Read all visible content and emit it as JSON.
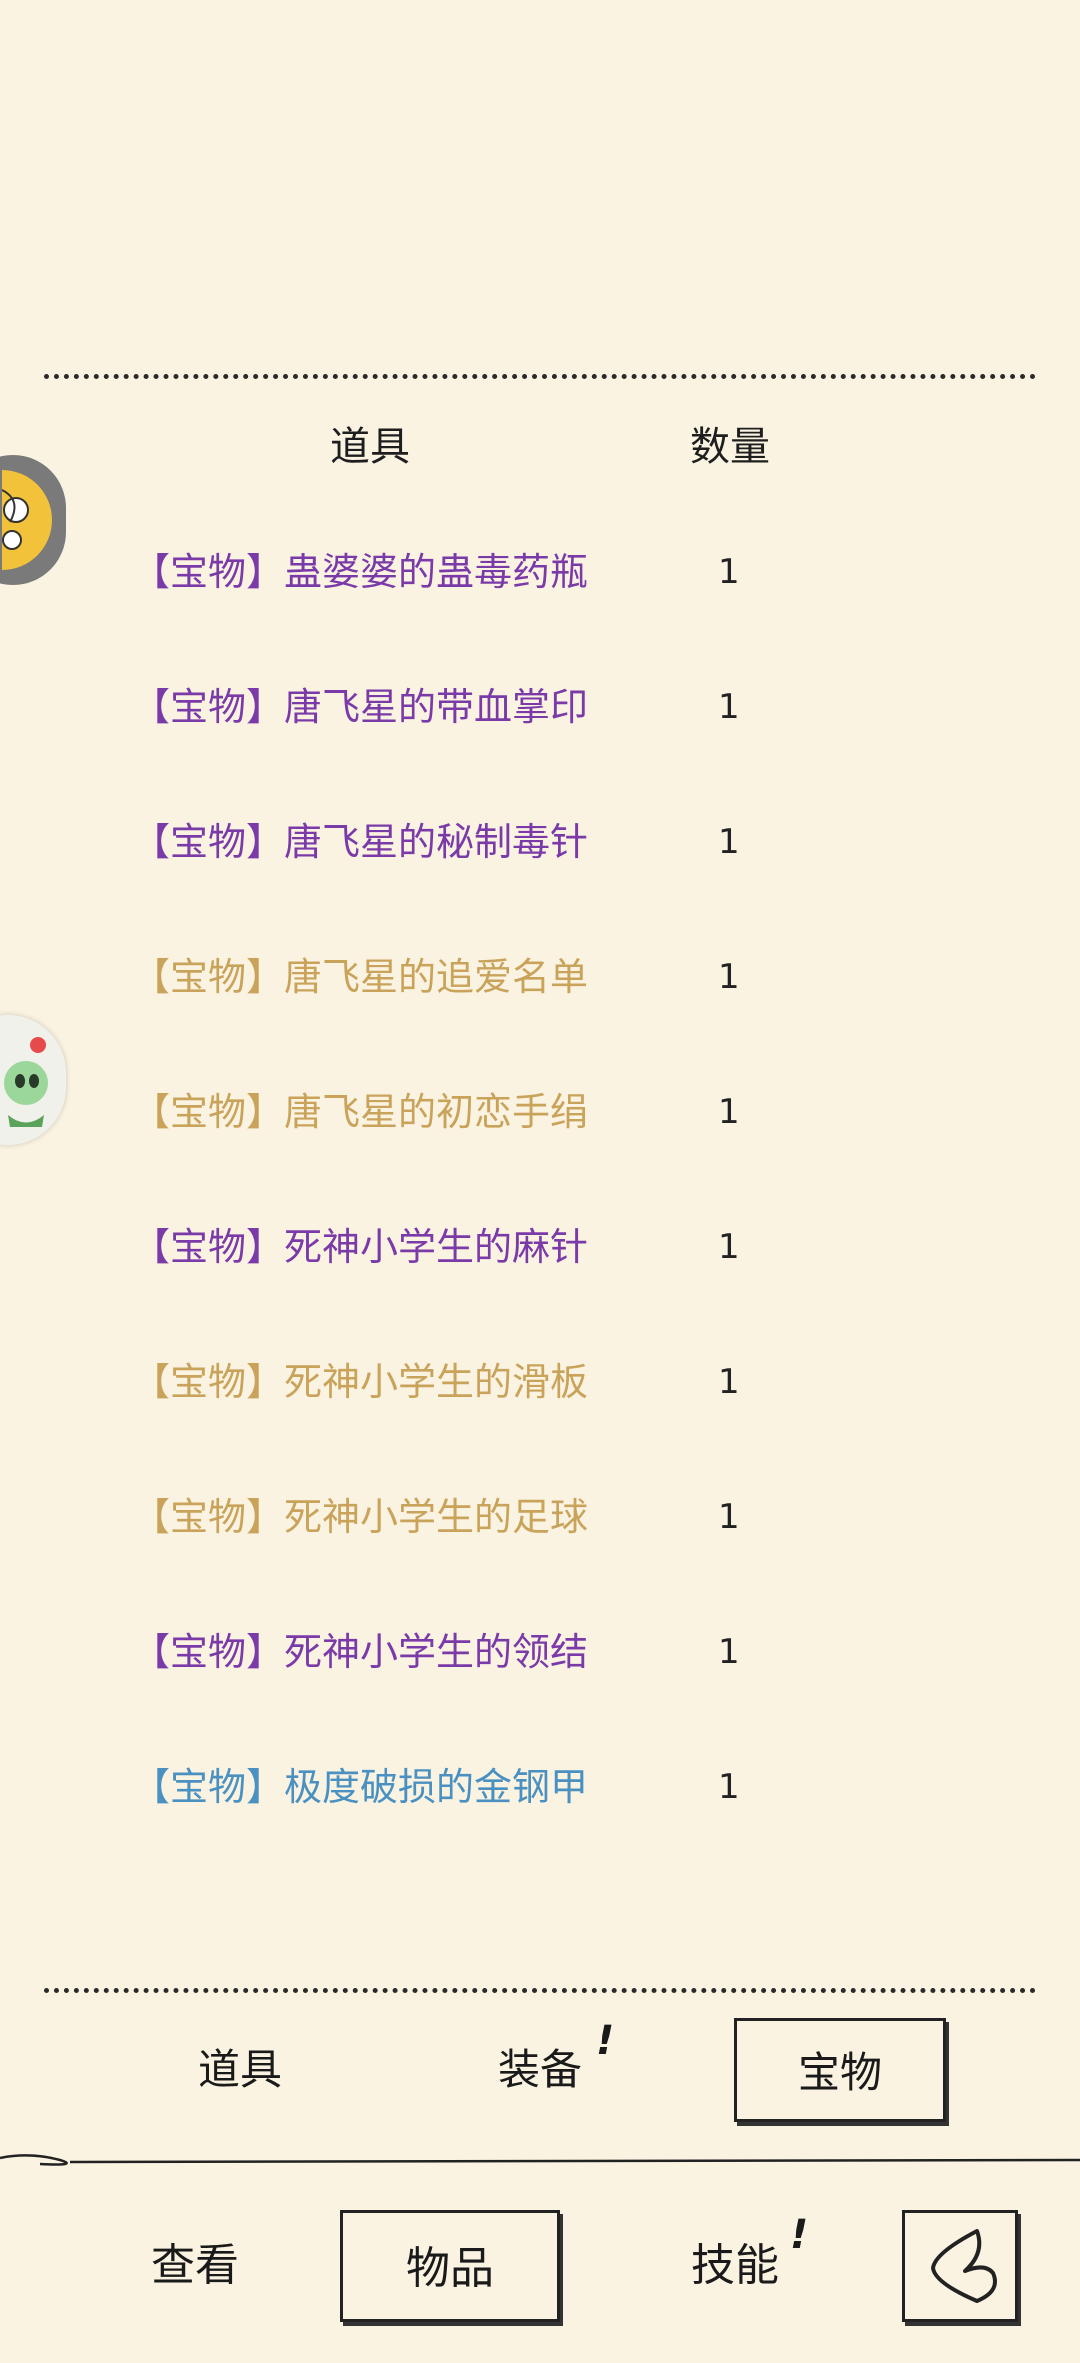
{
  "table": {
    "col_item": "道具",
    "col_qty": "数量",
    "items": [
      {
        "name": "【宝物】蛊婆婆的蛊毒药瓶",
        "qty": "1",
        "color": "#7a3aa8"
      },
      {
        "name": "【宝物】唐飞星的带血掌印",
        "qty": "1",
        "color": "#7a3aa8"
      },
      {
        "name": "【宝物】唐飞星的秘制毒针",
        "qty": "1",
        "color": "#7a3aa8"
      },
      {
        "name": "【宝物】唐飞星的追爱名单",
        "qty": "1",
        "color": "#c9a35a"
      },
      {
        "name": "【宝物】唐飞星的初恋手绢",
        "qty": "1",
        "color": "#c9a35a"
      },
      {
        "name": "【宝物】死神小学生的麻针",
        "qty": "1",
        "color": "#7a3aa8"
      },
      {
        "name": "【宝物】死神小学生的滑板",
        "qty": "1",
        "color": "#c9a35a"
      },
      {
        "name": "【宝物】死神小学生的足球",
        "qty": "1",
        "color": "#c9a35a"
      },
      {
        "name": "【宝物】死神小学生的领结",
        "qty": "1",
        "color": "#7a3aa8"
      },
      {
        "name": "【宝物】极度破损的金钢甲",
        "qty": "1",
        "color": "#4a90c0"
      }
    ]
  },
  "tabs": {
    "props": "道具",
    "equip": "装备",
    "equip_badge": "!",
    "treasure": "宝物"
  },
  "nav": {
    "view": "查看",
    "items": "物品",
    "skills": "技能",
    "skills_badge": "!"
  },
  "icons": {
    "back": "back-arrow-icon",
    "float_top": "cartoon-avatar-icon",
    "float_mid": "alien-avatar-icon"
  }
}
